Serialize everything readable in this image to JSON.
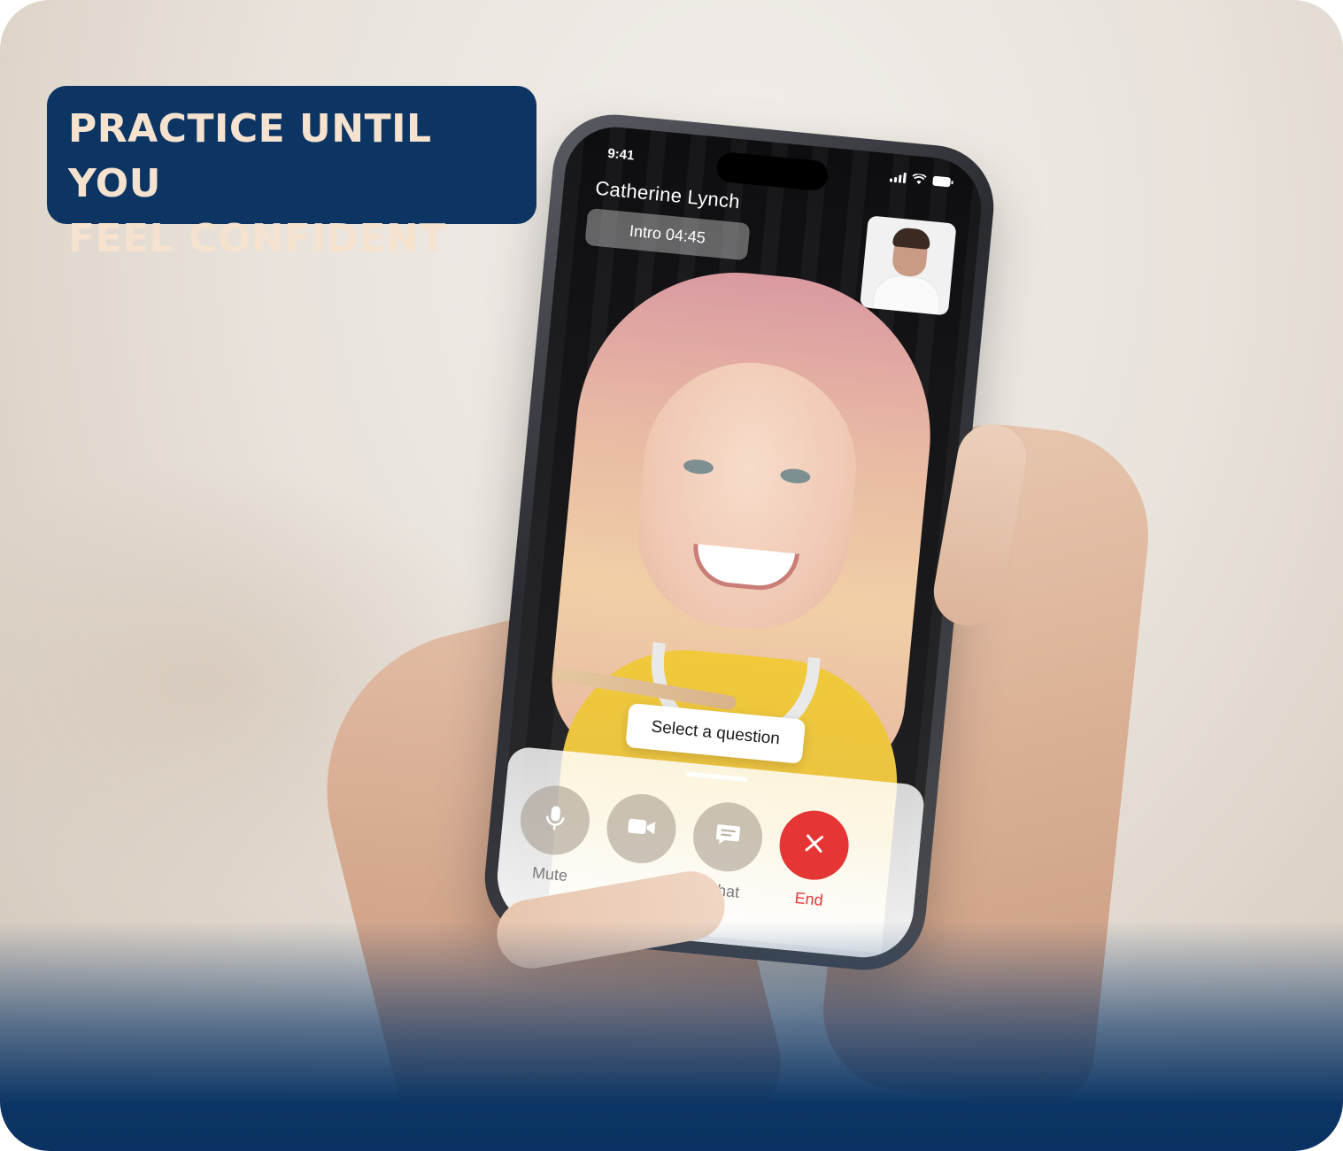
{
  "headline": {
    "line1": "PRACTICE UNTIL YOU",
    "line2": "FEEL CONFIDENT"
  },
  "status_bar": {
    "time": "9:41"
  },
  "call": {
    "caller_name": "Catherine Lynch",
    "timer": "Intro 04:45",
    "select_question_label": "Select a question"
  },
  "controls": {
    "mute_label": "Mute",
    "video_label": "",
    "chat_label": "Chat",
    "end_label": "End"
  },
  "colors": {
    "badge_bg": "#0d3563",
    "badge_text": "#f5e2cf",
    "end_button": "#e53535",
    "bottom_fade": "#0a3262"
  },
  "icons": [
    "mic-icon",
    "video-camera-icon",
    "chat-bubble-icon",
    "close-icon",
    "signal-icon",
    "wifi-icon",
    "battery-icon"
  ]
}
